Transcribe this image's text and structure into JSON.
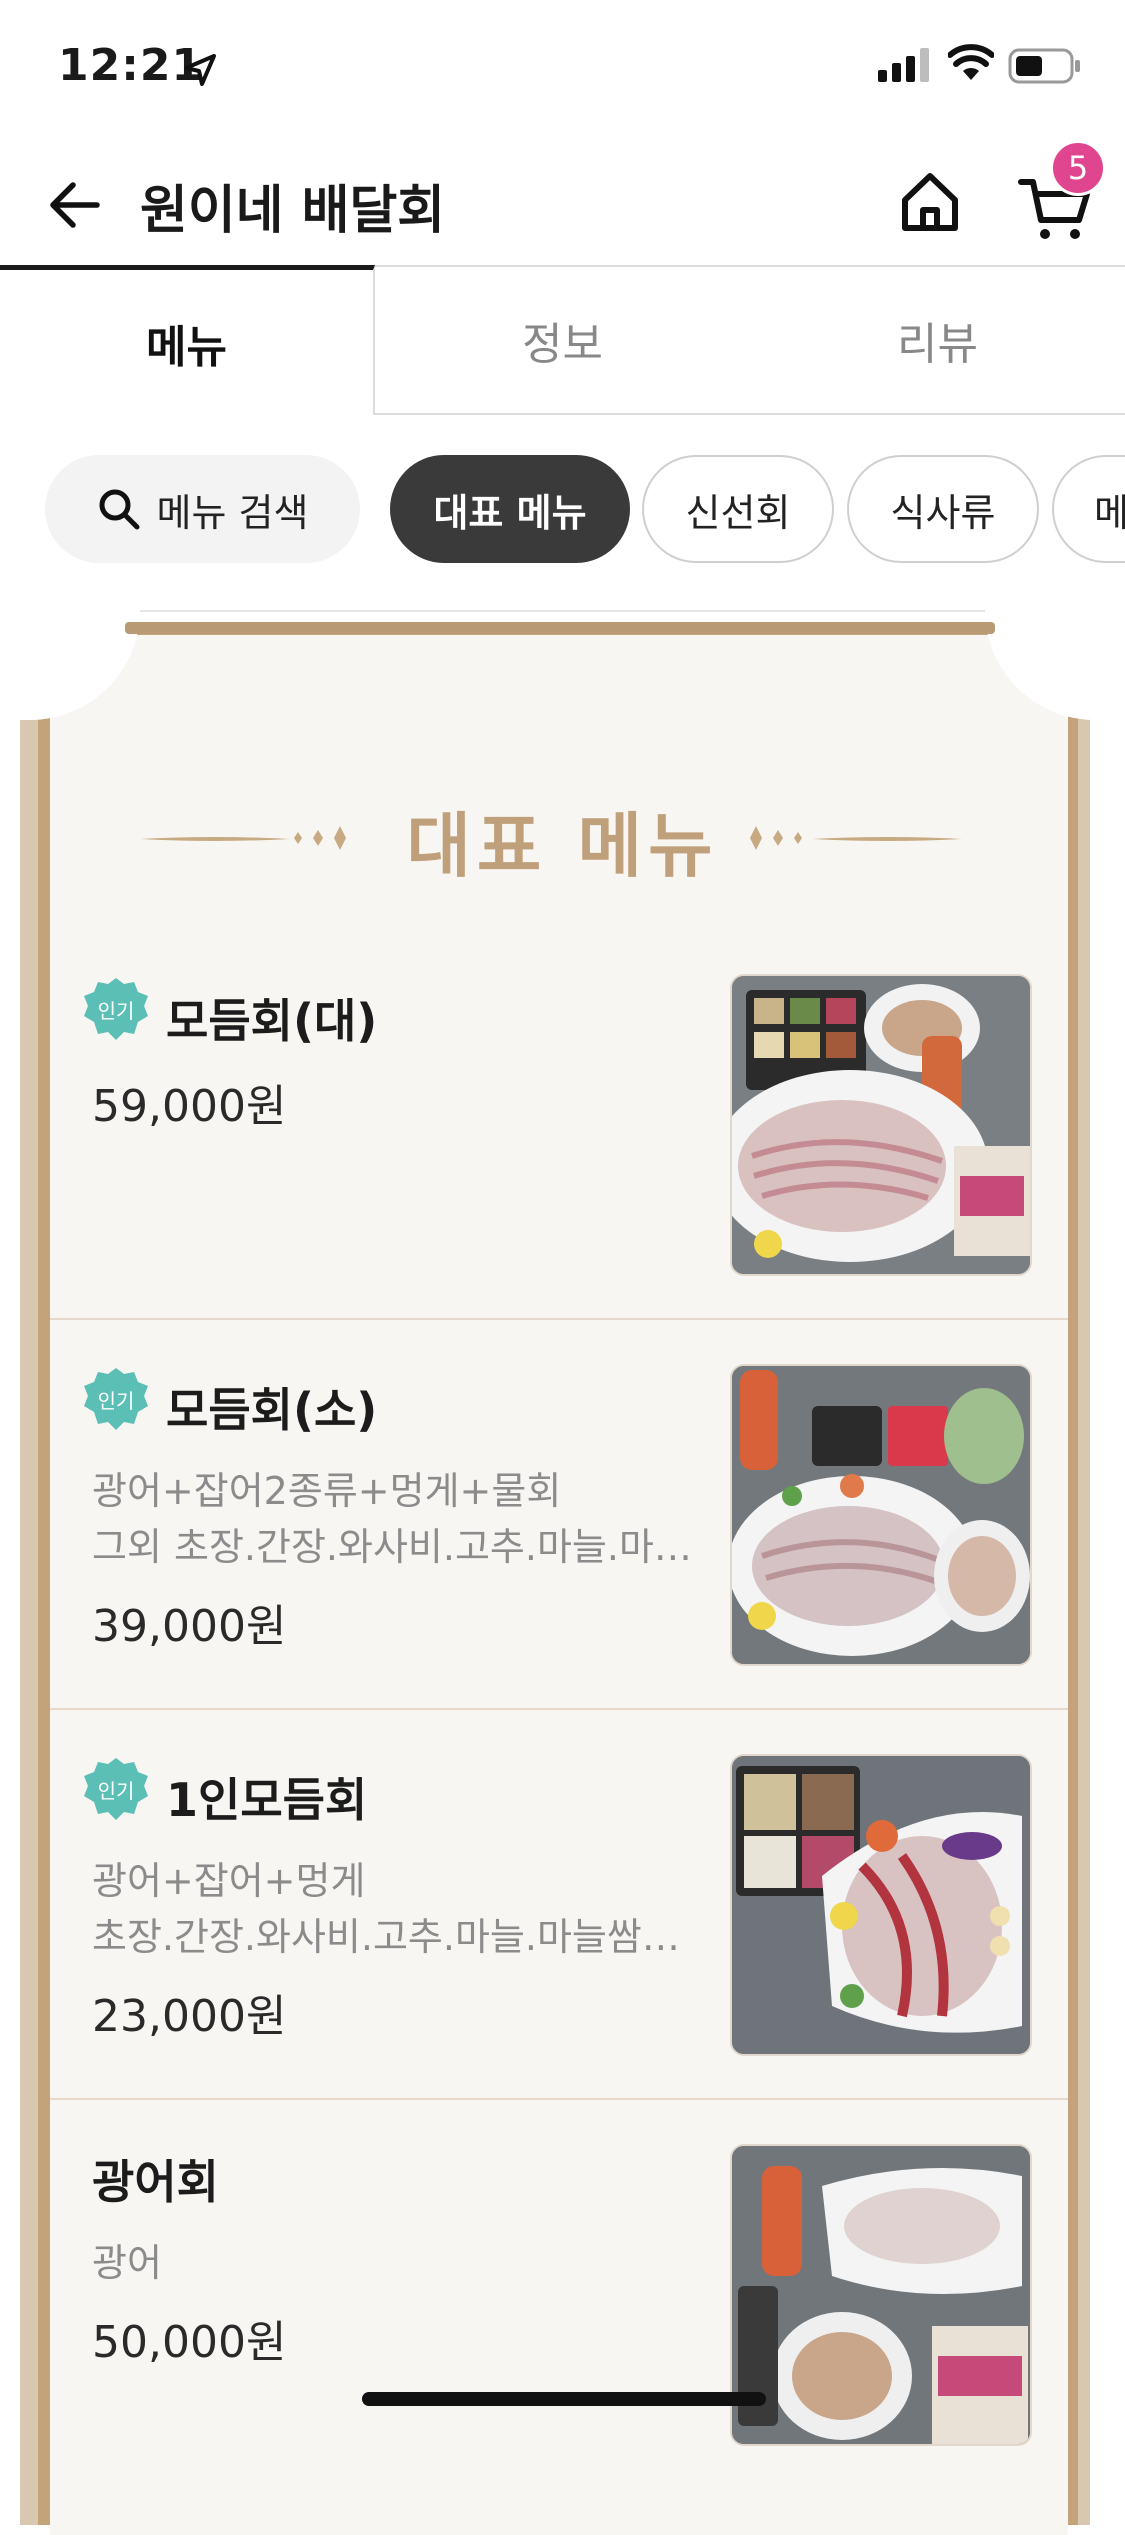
{
  "status_bar": {
    "time": "12:21"
  },
  "header": {
    "title": "원이네 배달회",
    "cart_count": "5"
  },
  "tabs": [
    {
      "label": "메뉴",
      "active": true
    },
    {
      "label": "정보",
      "active": false
    },
    {
      "label": "리뷰",
      "active": false
    }
  ],
  "chips": {
    "search_label": "메뉴 검색",
    "items": [
      "대표 메뉴",
      "신선회",
      "식사류",
      "메"
    ]
  },
  "section": {
    "heading": "대표 메뉴"
  },
  "menu_items": [
    {
      "badge": "인기",
      "name": "모듬회(대)",
      "desc1": "",
      "desc2": "",
      "price": "59,000원"
    },
    {
      "badge": "인기",
      "name": "모듬회(소)",
      "desc1": "광어+잡어2종류+멍게+물회",
      "desc2": "그외  초장.간장.와사비.고추.마늘.마…",
      "price": "39,000원"
    },
    {
      "badge": "인기",
      "name": "1인모듬회",
      "desc1": "광어+잡어+멍게",
      "desc2": "초장.간장.와사비.고추.마늘.마늘쌈…",
      "price": "23,000원"
    },
    {
      "badge": "",
      "name": "광어회",
      "desc1": "광어",
      "desc2": "",
      "price": "50,000원"
    }
  ],
  "colors": {
    "accent_badge": "#5bbfb5",
    "cart_badge": "#e0458f",
    "heading": "#c0a07a",
    "active_chip": "#3a3a3a"
  }
}
